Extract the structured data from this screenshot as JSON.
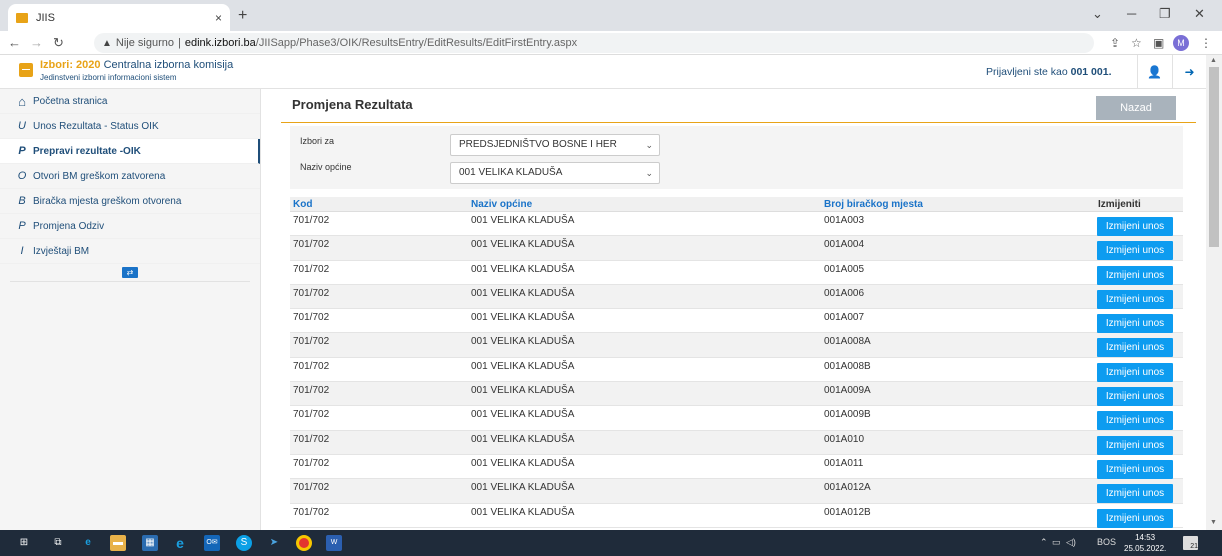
{
  "browser": {
    "tab_title": "JIIS",
    "tab_close": "×",
    "new_tab": "+",
    "security_label": "Nije sigurno",
    "url_separator": "|",
    "url_host": "edink.izbori.ba",
    "url_path": "/JIISapp/Phase3/OIK/ResultsEntry/EditResults/EditFirstEntry.aspx",
    "profile_initial": "M"
  },
  "header": {
    "title_year_prefix": "Izbori: 2020",
    "title_org": " Centralna izborna komisija",
    "subtitle": "Jedinstveni izborni informacioni sistem",
    "logged_in_label": "Prijavljeni ste kao",
    "logged_in_user": "001 001."
  },
  "sidebar": {
    "items": [
      {
        "label": "Početna stranica",
        "icon": "home-icon",
        "glyph": "⌂"
      },
      {
        "label": "Unos Rezultata - Status OIK",
        "icon": "letter-u-icon",
        "glyph": "U"
      },
      {
        "label": "Prepravi rezultate -OIK",
        "icon": "letter-p-icon",
        "glyph": "P"
      },
      {
        "label": "Otvori BM greškom zatvorena",
        "icon": "letter-o-icon",
        "glyph": "O"
      },
      {
        "label": "Biračka mjesta greškom otvorena",
        "icon": "letter-b-icon",
        "glyph": "B"
      },
      {
        "label": "Promjena Odziv",
        "icon": "letter-p-icon",
        "glyph": "P"
      },
      {
        "label": "Izvještaji BM",
        "icon": "letter-i-icon",
        "glyph": "I"
      }
    ],
    "active_index": 2
  },
  "main": {
    "title": "Promjena Rezultata",
    "back_button": "Nazad",
    "filters": {
      "izbori_label": "Izbori za",
      "izbori_value": "PREDSJEDNIŠTVO BOSNE I HER",
      "opcina_label": "Naziv općine",
      "opcina_value": "001 VELIKA KLADUŠA"
    },
    "table": {
      "columns": [
        "Kod",
        "Naziv općine",
        "Broj biračkog mjesta",
        "Izmijeniti"
      ],
      "edit_label": "Izmijeni unos",
      "rows": [
        {
          "kod": "701/702",
          "opcina": "001 VELIKA KLADUŠA",
          "bm": "001A003"
        },
        {
          "kod": "701/702",
          "opcina": "001 VELIKA KLADUŠA",
          "bm": "001A004"
        },
        {
          "kod": "701/702",
          "opcina": "001 VELIKA KLADUŠA",
          "bm": "001A005"
        },
        {
          "kod": "701/702",
          "opcina": "001 VELIKA KLADUŠA",
          "bm": "001A006"
        },
        {
          "kod": "701/702",
          "opcina": "001 VELIKA KLADUŠA",
          "bm": "001A007"
        },
        {
          "kod": "701/702",
          "opcina": "001 VELIKA KLADUŠA",
          "bm": "001A008A"
        },
        {
          "kod": "701/702",
          "opcina": "001 VELIKA KLADUŠA",
          "bm": "001A008B"
        },
        {
          "kod": "701/702",
          "opcina": "001 VELIKA KLADUŠA",
          "bm": "001A009A"
        },
        {
          "kod": "701/702",
          "opcina": "001 VELIKA KLADUŠA",
          "bm": "001A009B"
        },
        {
          "kod": "701/702",
          "opcina": "001 VELIKA KLADUŠA",
          "bm": "001A010"
        },
        {
          "kod": "701/702",
          "opcina": "001 VELIKA KLADUŠA",
          "bm": "001A011"
        },
        {
          "kod": "701/702",
          "opcina": "001 VELIKA KLADUŠA",
          "bm": "001A012A"
        },
        {
          "kod": "701/702",
          "opcina": "001 VELIKA KLADUŠA",
          "bm": "001A012B"
        }
      ]
    }
  },
  "taskbar": {
    "language": "BOS",
    "time": "14:53",
    "date": "25.05.2022.",
    "notification_count": "21"
  },
  "colors": {
    "brand_orange": "#e8a317",
    "brand_navy": "#1f4e79",
    "edit_button_blue": "#0d9cf0",
    "header_link_blue": "#1a73c8"
  }
}
